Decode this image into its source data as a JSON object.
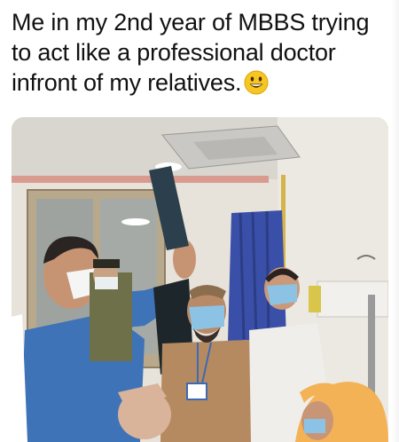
{
  "post": {
    "caption": "Me in my 2nd year of MBBS trying to act like a professional doctor infront of my relatives."
  },
  "icons": {
    "caption_emoji": "grinning-face-emoji"
  },
  "colors": {
    "caption_text": "#111111",
    "emoji_face": "#f7c624"
  }
}
